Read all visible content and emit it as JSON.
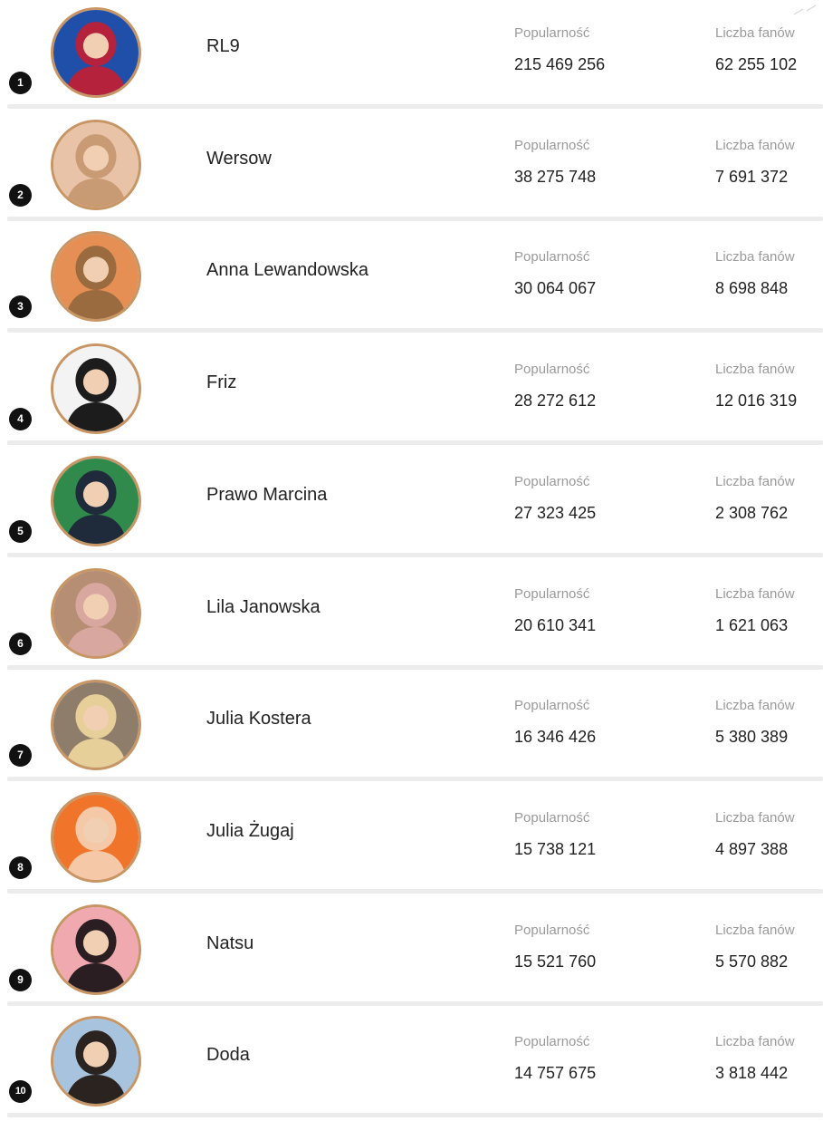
{
  "ranking": {
    "popularity_label": "Popularność",
    "fans_label": "Liczba fanów",
    "accent_border_color": "#c89564",
    "rank_badge_color": "#111111",
    "items": [
      {
        "rank": "1",
        "name": "RL9",
        "popularity": "215 469 256",
        "fans": "62 255 102",
        "avatar_bg": "#1f4fa8",
        "avatar_fg": "#b5223c"
      },
      {
        "rank": "2",
        "name": "Wersow",
        "popularity": "38 275 748",
        "fans": "7 691 372",
        "avatar_bg": "#e9c3a7",
        "avatar_fg": "#c99b75"
      },
      {
        "rank": "3",
        "name": "Anna Lewandowska",
        "popularity": "30 064 067",
        "fans": "8 698 848",
        "avatar_bg": "#e58f55",
        "avatar_fg": "#9a6b3f"
      },
      {
        "rank": "4",
        "name": "Friz",
        "popularity": "28 272 612",
        "fans": "12 016 319",
        "avatar_bg": "#f3f3f3",
        "avatar_fg": "#1c1c1c"
      },
      {
        "rank": "5",
        "name": "Prawo Marcina",
        "popularity": "27 323 425",
        "fans": "2 308 762",
        "avatar_bg": "#2f8a4c",
        "avatar_fg": "#1f2a3a"
      },
      {
        "rank": "6",
        "name": "Lila Janowska",
        "popularity": "20 610 341",
        "fans": "1 621 063",
        "avatar_bg": "#b58e74",
        "avatar_fg": "#d8a7a0"
      },
      {
        "rank": "7",
        "name": "Julia Kostera",
        "popularity": "16 346 426",
        "fans": "5 380 389",
        "avatar_bg": "#8f7d6c",
        "avatar_fg": "#e6cf98"
      },
      {
        "rank": "8",
        "name": "Julia Żugaj",
        "popularity": "15 738 121",
        "fans": "4 897 388",
        "avatar_bg": "#f0742a",
        "avatar_fg": "#f5c9a7"
      },
      {
        "rank": "9",
        "name": "Natsu",
        "popularity": "15 521 760",
        "fans": "5 570 882",
        "avatar_bg": "#f1a9b0",
        "avatar_fg": "#2a1e22"
      },
      {
        "rank": "10",
        "name": "Doda",
        "popularity": "14 757 675",
        "fans": "3 818 442",
        "avatar_bg": "#a8c3de",
        "avatar_fg": "#2a2320"
      }
    ]
  }
}
